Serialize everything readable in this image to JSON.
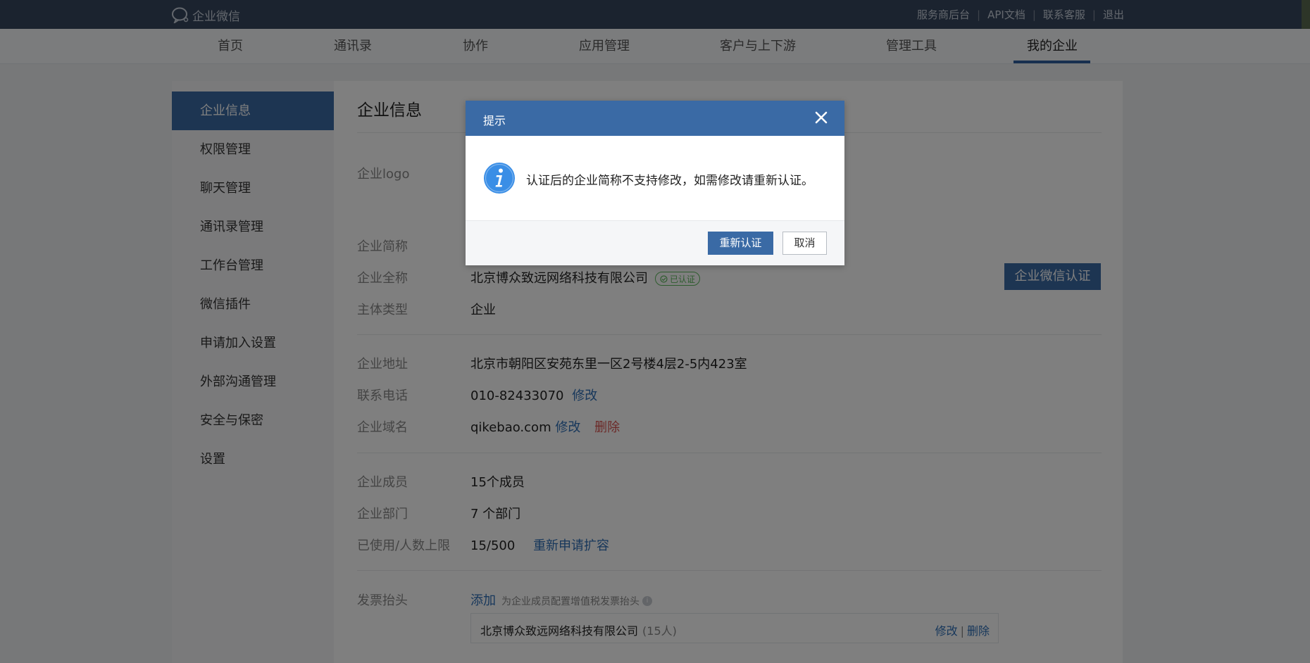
{
  "app": {
    "logo_text": "企业微信",
    "top_links": [
      "服务商后台",
      "API文档",
      "联系客服",
      "退出"
    ]
  },
  "nav": {
    "items": [
      "首页",
      "通讯录",
      "协作",
      "应用管理",
      "客户与上下游",
      "管理工具",
      "我的企业"
    ],
    "active": "我的企业"
  },
  "sidebar": {
    "items": [
      "企业信息",
      "权限管理",
      "聊天管理",
      "通讯录管理",
      "工作台管理",
      "微信插件",
      "申请加入设置",
      "外部沟通管理",
      "安全与保密",
      "设置"
    ]
  },
  "main": {
    "title": "企业信息",
    "logo_label": "企业logo",
    "short_name_label": "企业简称",
    "full_name_label": "企业全称",
    "full_name": "北京博众致远网络科技有限公司",
    "verified_badge": "已认证",
    "cert_button": "企业微信认证",
    "entity_type_label": "主体类型",
    "entity_type": "企业",
    "address_label": "企业地址",
    "address": "北京市朝阳区安苑东里一区2号楼4层2-5内423室",
    "phone_label": "联系电话",
    "phone": "010-82433070",
    "edit_link": "修改",
    "domain_label": "企业域名",
    "domain": "qikebao.com",
    "delete_link": "删除",
    "members_label": "企业成员",
    "members": "15个成员",
    "departments_label": "企业部门",
    "departments": "7 个部门",
    "usage_label": "已使用/人数上限",
    "usage": "15/500",
    "expand_link": "重新申请扩容",
    "invoice_label": "发票抬头",
    "invoice_add": "添加",
    "invoice_hint": "为企业成员配置增值税发票抬头",
    "invoice_name": "北京博众致远网络科技有限公司",
    "invoice_count": "(15人)",
    "invoice_edit": "修改",
    "invoice_delete": "删除"
  },
  "dialog": {
    "title": "提示",
    "message": "认证后的企业简称不支持修改，如需修改请重新认证。",
    "confirm": "重新认证",
    "cancel": "取消"
  },
  "colors": {
    "topbar": "#36465e",
    "accent": "#3a6aa5",
    "link": "#2e6fb7",
    "danger": "#d9534f",
    "verified": "#5cb85c"
  }
}
